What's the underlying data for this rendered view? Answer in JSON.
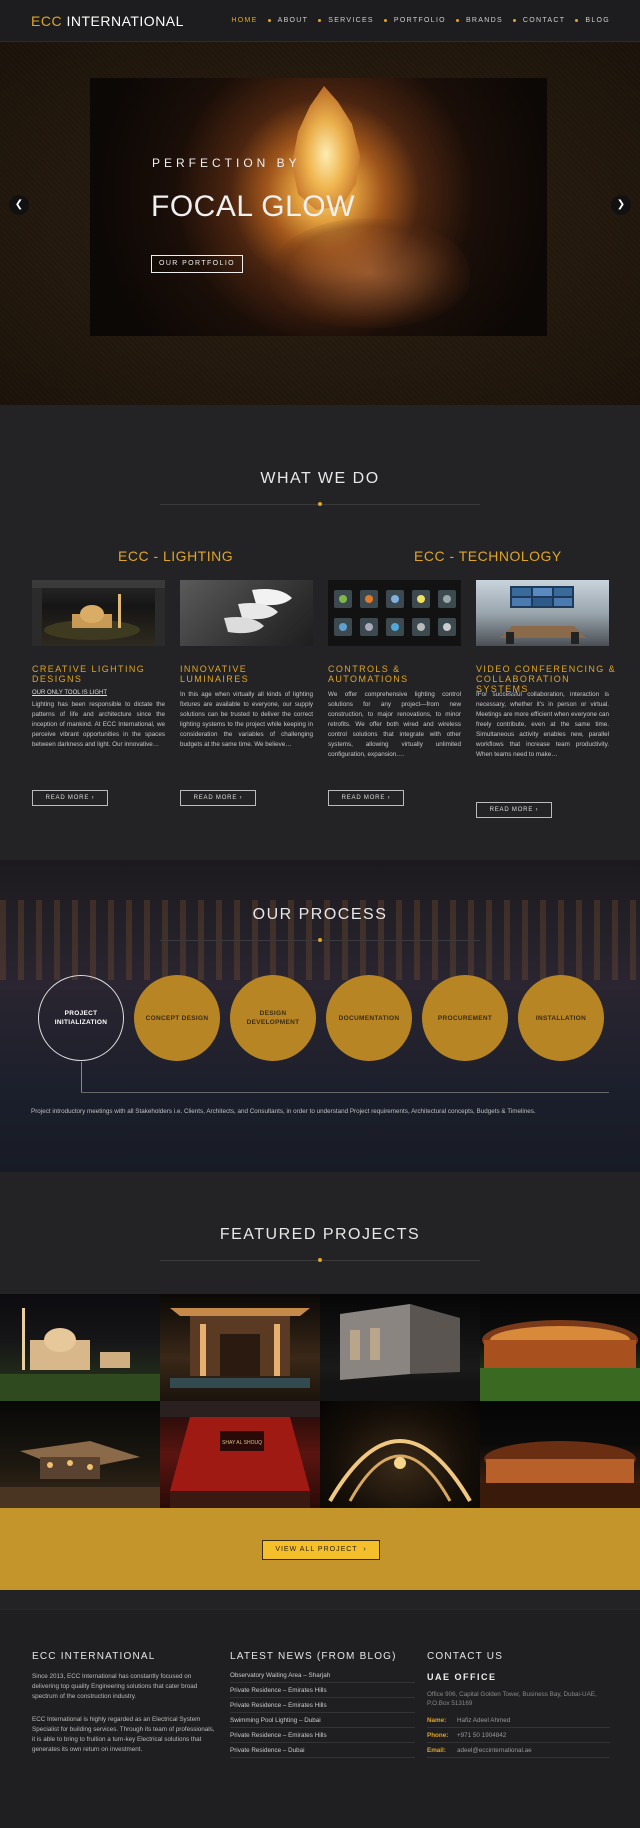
{
  "header": {
    "logo_accent": "ECC",
    "logo_rest": " INTERNATIONAL",
    "nav": [
      "HOME",
      "ABOUT",
      "SERVICES",
      "PORTFOLIO",
      "BRANDS",
      "CONTACT",
      "BLOG"
    ],
    "active_nav": "HOME"
  },
  "hero": {
    "pre_title": "PERFECTION BY",
    "title": "FOCAL GLOW",
    "cta": "OUR PORTFOLIO",
    "prev_icon": "chevron-left-icon",
    "next_icon": "chevron-right-icon"
  },
  "what_we_do": {
    "title": "WHAT WE DO",
    "groups": [
      "ECC - LIGHTING",
      "ECC - TECHNOLOGY"
    ],
    "services": [
      {
        "title": "CREATIVE LIGHTING DESIGNS",
        "subtitle": "OUR ONLY TOOL IS LIGHT",
        "text": "Lighting has been responsible to dictate the patterns of life and architecture since the inception of mankind. At ECC International, we perceive vibrant opportunities in the spaces between darkness and light. Our innovative…",
        "button": "READ MORE"
      },
      {
        "title": "INNOVATIVE LUMINAIRES",
        "subtitle": "",
        "text": "In this age when virtually all kinds of lighting fixtures are available to everyone, our supply solutions can be trusted to deliver the correct lighting systems to the project while keeping in consideration the variables of challenging budgets at the same time. We believe…",
        "button": "READ MORE"
      },
      {
        "title": "CONTROLS & AUTOMATIONS",
        "subtitle": "",
        "text": "We offer comprehensive lighting control solutions for any project—from new construction, to major renovations, to minor retrofits. We offer both wired and wireless control solutions that integrate with other systems, allowing virtually unlimited configuration, expansion.…",
        "button": "READ MORE"
      },
      {
        "title": "VIDEO CONFERENCING & COLLABORATION SYSTEMS",
        "subtitle": "",
        "text": "IFor successful collaboration, interaction is necessary, whether it's in person or virtual. Meetings are more efficient when everyone can freely contribute, even at the same time. Simultaneous activity enables new, parallel workflows that increase team productivity. When teams need to make…",
        "button": "READ MORE"
      }
    ],
    "control_labels": [
      "Home",
      "Security",
      "Climate",
      "Lighting",
      "Media",
      "Irrigation",
      "Video",
      "Pool",
      "Intercom"
    ]
  },
  "process": {
    "title": "OUR PROCESS",
    "steps": [
      "PROJECT INITIALIZATION",
      "CONCEPT DESIGN",
      "DESIGN DEVELOPMENT",
      "DOCUMENTATION",
      "PROCUREMENT",
      "INSTALLATION"
    ],
    "active_step": 0,
    "description": "Project introductory meetings with all Stakeholders i.e. Clients, Architects, and Consultants, in order to understand Project requirements, Architectural concepts, Budgets & Timelines."
  },
  "projects": {
    "title": "FEATURED PROJECTS",
    "cta": "VIEW ALL PROJECT",
    "cta_icon": "chevron-right-icon",
    "sign_text": "SHAY AL SHOUQ"
  },
  "footer": {
    "about_title": "ECC INTERNATIONAL",
    "about_p1": "Since 2013, ECC International has constantly focused on delivering top quality Engineering solutions that cater broad spectrum of the construction industry.",
    "about_p2": "ECC International is highly regarded as an Electrical System Specialist for building services. Through its team of professionals, it is able to bring to fruition a turn-key Electrical solutions that generates its own return on investment.",
    "news_title": "LATEST NEWS (FROM BLOG)",
    "news": [
      "Observatory Waiting Area – Sharjah",
      "Private Residence – Emirates Hills",
      "Private Residence – Emirates Hills",
      "Swimming Pool Lighting – Dubai",
      "Private Residence – Emirates Hills",
      "Private Residence – Dubai"
    ],
    "contact_title": "CONTACT US",
    "office_title": "UAE OFFICE",
    "office_address": "Office 906, Capital Golden Tower, Business Bay, Dubai-UAE, P.O.Box 513169",
    "contacts": [
      {
        "label": "Name:",
        "value": "Hafiz Adeel Ahmed"
      },
      {
        "label": "Phone:",
        "value": "+971 50 1904842"
      },
      {
        "label": "Email:",
        "value": "adeel@eccinternational.ae"
      }
    ]
  },
  "colors": {
    "accent": "#e0a526",
    "background": "#232325",
    "cta_band": "#c4952a",
    "step_circle": "#b88524"
  }
}
